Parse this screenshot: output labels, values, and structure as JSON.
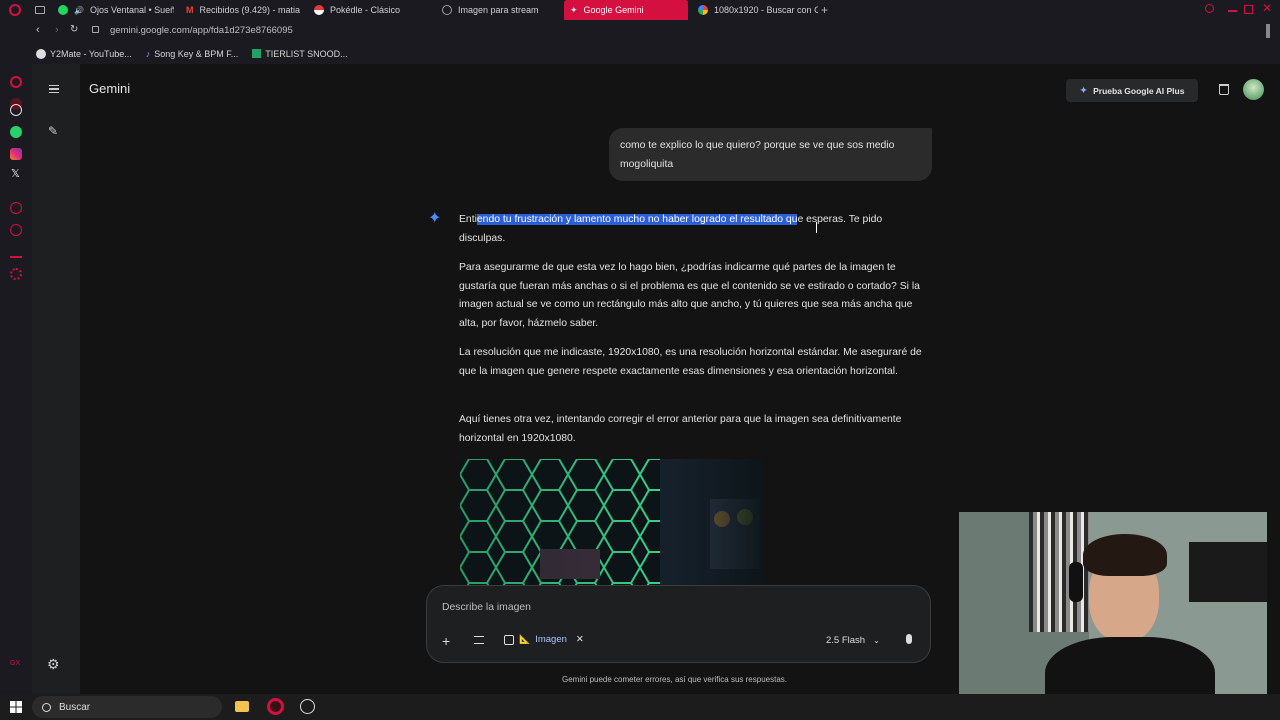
{
  "browser": {
    "tabs": [
      {
        "label": "Ojos Ventanal • Sueñ",
        "color": "#1ed760"
      },
      {
        "label": "Recibidos (9.429) - matia",
        "color": "#ea4335"
      },
      {
        "label": "Pokédle - Clásico",
        "color": "#e53935"
      },
      {
        "label": "Imagen para stream",
        "color": "#9e9e9e"
      },
      {
        "label": "Google Gemini",
        "color": "#8ab4f8"
      },
      {
        "label": "1080x1920 - Buscar con G",
        "color": "#4285f4"
      }
    ],
    "url": "gemini.google.com/app/fda1d273e8766095",
    "bookmarks": [
      "Y2Mate - YouTube...",
      "Song Key & BPM F...",
      "TIERLIST SNOOD..."
    ]
  },
  "gemini": {
    "title": "Gemini",
    "upgrade_label": "Prueba Google AI Plus",
    "user_message": "como te explico lo que quiero? porque se ve que sos medio mogoliquita",
    "response": {
      "p1_before": "Enti",
      "p1_highlight": "endo tu frustración y lamento mucho no haber logrado el resultado qu",
      "p1_after": "e esperas. Te pido disculpas.",
      "p2": "Para asegurarme de que esta vez lo hago bien, ¿podrías indicarme qué partes de la imagen te gustaría que fueran más anchas o si el problema es que el contenido se ve estirado o cortado? Si la imagen actual se ve como un rectángulo más alto que ancho, y tú quieres que sea más ancha que alta, por favor, házmelo saber.",
      "p3": "La resolución que me indicaste, 1920x1080, es una resolución horizontal estándar. Me aseguraré de que la imagen que genere respete exactamente esas dimensiones y esa orientación horizontal.",
      "p4": "Aquí tienes otra vez, intentando corregir el error anterior para que la imagen sea definitivamente horizontal en 1920x1080."
    },
    "input": {
      "placeholder": "Describe la imagen",
      "chip_label": "Imagen",
      "chip_emoji": "📐",
      "model": "2.5 Flash"
    },
    "disclaimer": "Gemini puede cometer errores, así que verifica sus respuestas."
  },
  "taskbar": {
    "search_label": "Buscar"
  }
}
